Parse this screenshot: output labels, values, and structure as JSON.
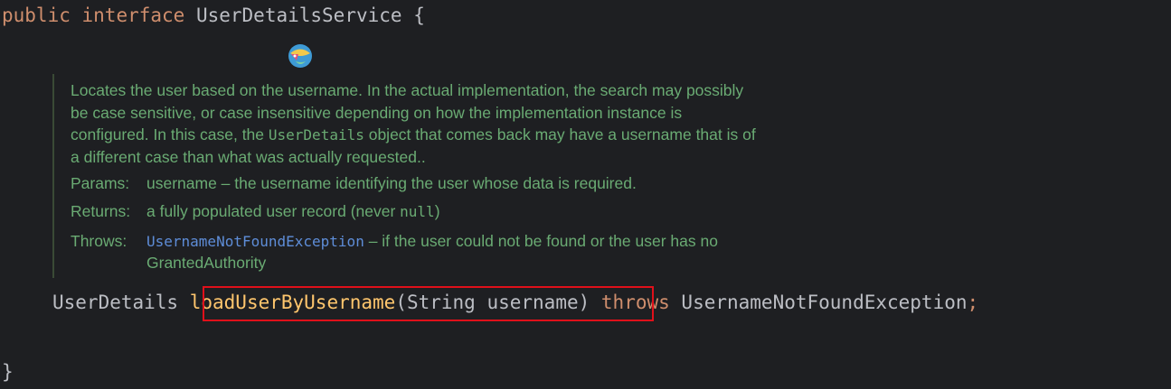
{
  "code": {
    "line1": {
      "kw1": "public",
      "kw2": "interface",
      "name": "UserDetailsService",
      "brace": "{"
    },
    "signature": {
      "return_type": "UserDetails",
      "method": "loadUserByUsername",
      "params": "(String username)",
      "throws_kw": "throws",
      "exception": "UsernameNotFoundException",
      "semicolon": ";"
    },
    "closing_brace": "}"
  },
  "doc": {
    "desc_line1": "Locates the user based on the username. In the actual implementation, the search may possibly",
    "desc_line2": "be case sensitive, or case insensitive depending on how the implementation instance is",
    "desc_line3_pre": "configured. In this case, the ",
    "desc_line3_code": "UserDetails",
    "desc_line3_post": " object that comes back may have a username that is of",
    "desc_line4": "a different case than what was actually requested..",
    "params_label": "Params:",
    "params_value": "username – the username identifying the user whose data is required.",
    "returns_label": "Returns:",
    "returns_value_pre": "a fully populated user record (never ",
    "returns_value_code": "null",
    "returns_value_post": ")",
    "throws_label": "Throws:",
    "throws_link": "UsernameNotFoundException",
    "throws_value_post": " – if the user could not be found or the user has no",
    "throws_value_line2": "GrantedAuthority"
  },
  "colors": {
    "background": "#1e1f22",
    "keyword": "#cf8e6d",
    "doc_text": "#6aab73",
    "doc_link": "#5e8dd8",
    "method": "#ffc66d",
    "highlight_border": "#e0101a"
  },
  "icons": {
    "ai_assistant": "ai-assistant-icon"
  }
}
